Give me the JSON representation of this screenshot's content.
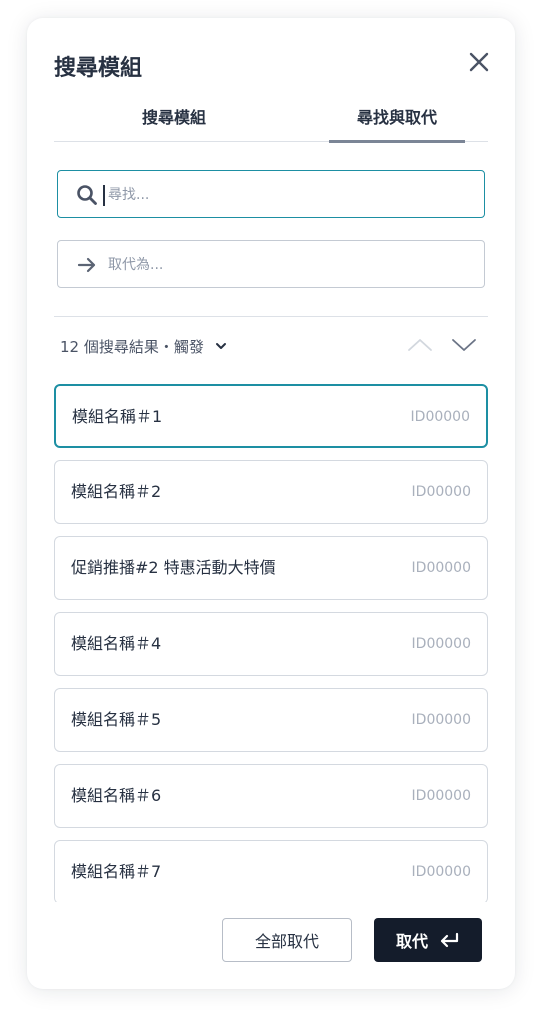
{
  "dialog": {
    "title": "搜尋模組",
    "close_icon": "close-icon"
  },
  "tabs": [
    {
      "label": "搜尋模組",
      "active": false
    },
    {
      "label": "尋找與取代",
      "active": true
    }
  ],
  "search": {
    "placeholder": "尋找...",
    "icon": "search-icon"
  },
  "replace": {
    "placeholder": "取代為...",
    "icon": "arrow-right-icon"
  },
  "results": {
    "summary": "12 個搜尋結果・觸發"
  },
  "items": [
    {
      "name": "模組名稱＃1",
      "id": "ID00000",
      "active": true
    },
    {
      "name": "模組名稱＃2",
      "id": "ID00000"
    },
    {
      "name": "促銷推播#2 特惠活動大特價",
      "id": "ID00000"
    },
    {
      "name": "模組名稱＃4",
      "id": "ID00000"
    },
    {
      "name": "模組名稱＃5",
      "id": "ID00000"
    },
    {
      "name": "模組名稱＃6",
      "id": "ID00000"
    },
    {
      "name": "模組名稱＃7",
      "id": "ID00000"
    }
  ],
  "actions": {
    "replace_all": "全部取代",
    "replace": "取代",
    "enter_icon": "enter-icon"
  },
  "colors": {
    "accent": "#1d8fa3",
    "primary_button": "#141c2b",
    "text": "#273142"
  }
}
